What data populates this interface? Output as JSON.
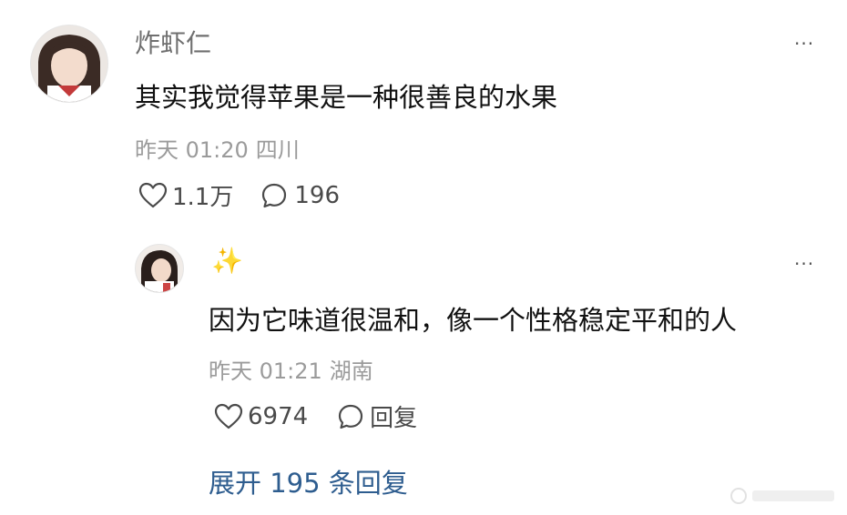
{
  "main_comment": {
    "author": "炸虾仁",
    "text": "其实我觉得苹果是一种很善良的水果",
    "time": "昨天 01:20",
    "location": "四川",
    "likes": "1.1万",
    "replies": "196",
    "more": "···"
  },
  "reply": {
    "author": "✨",
    "text": "因为它味道很温和，像一个性格稳定平和的人",
    "time": "昨天 01:21",
    "location": "湖南",
    "likes": "6974",
    "reply_label": "回复",
    "more": "···"
  },
  "expand_label": "展开 195 条回复"
}
